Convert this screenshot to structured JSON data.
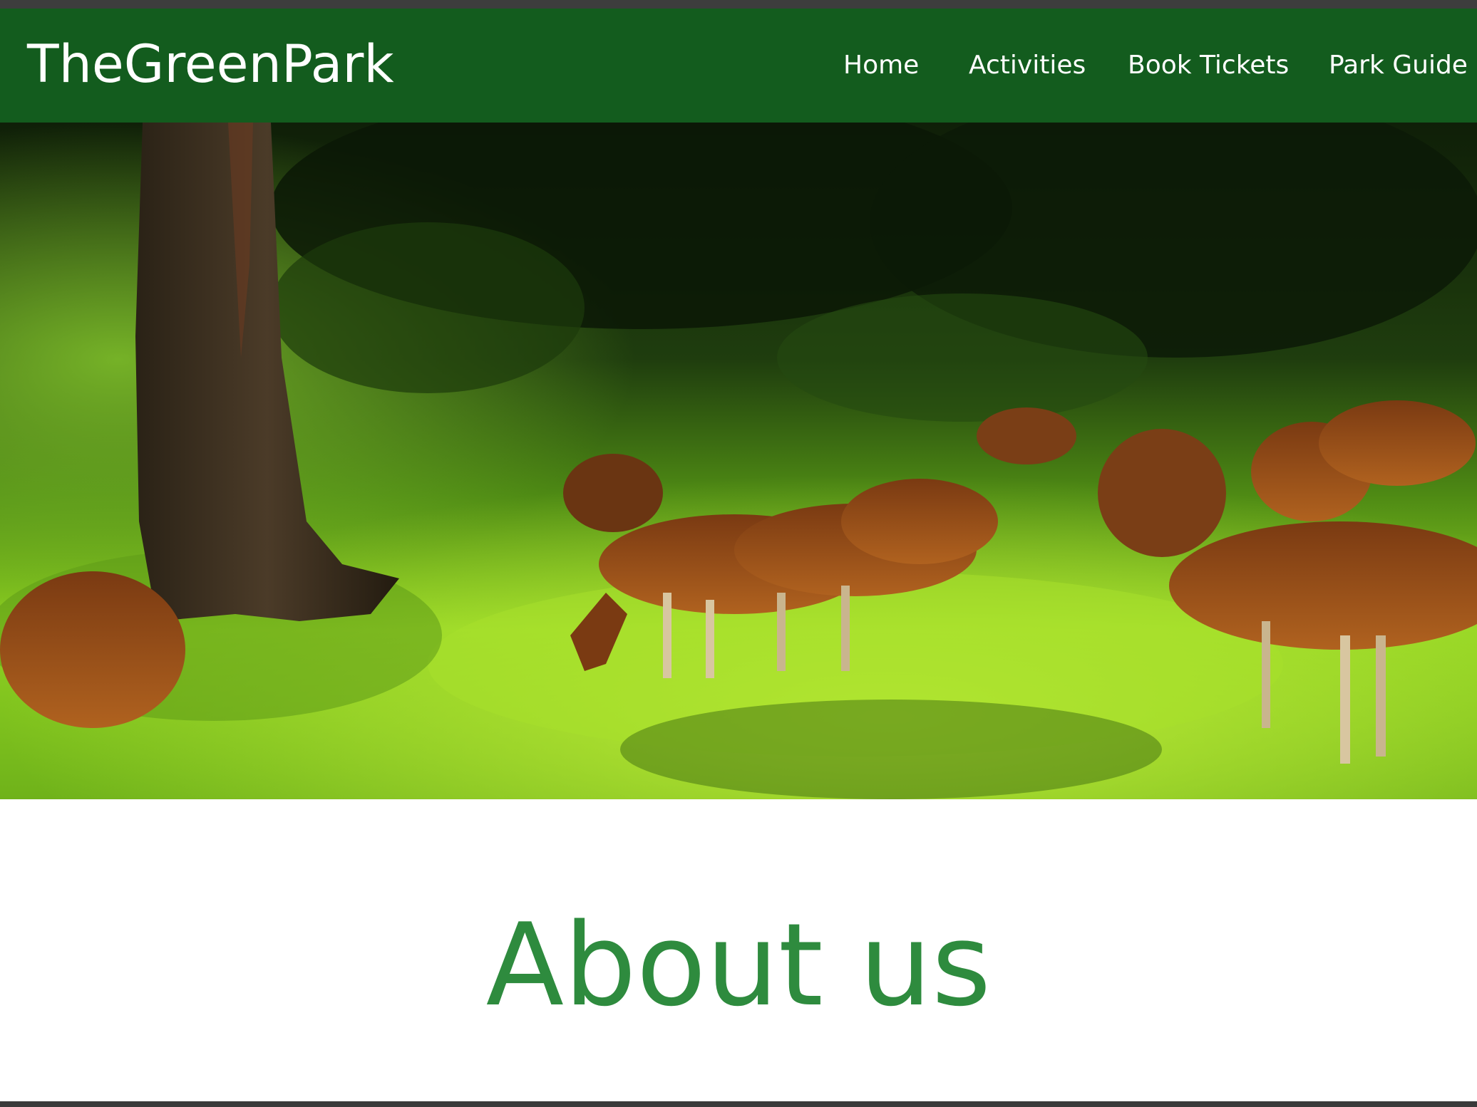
{
  "site": {
    "brand": "TheGreenPark"
  },
  "nav": {
    "items": [
      {
        "label": "Home"
      },
      {
        "label": "Activities"
      },
      {
        "label": "Book Tickets"
      },
      {
        "label": "Park Guide"
      }
    ]
  },
  "hero": {
    "image": "deer-grazing-in-forest-clearing"
  },
  "about": {
    "title": "About us"
  },
  "colors": {
    "navbar_bg": "#135c1e",
    "nav_text": "#ffffff",
    "heading_green": "#2e8b3e"
  }
}
